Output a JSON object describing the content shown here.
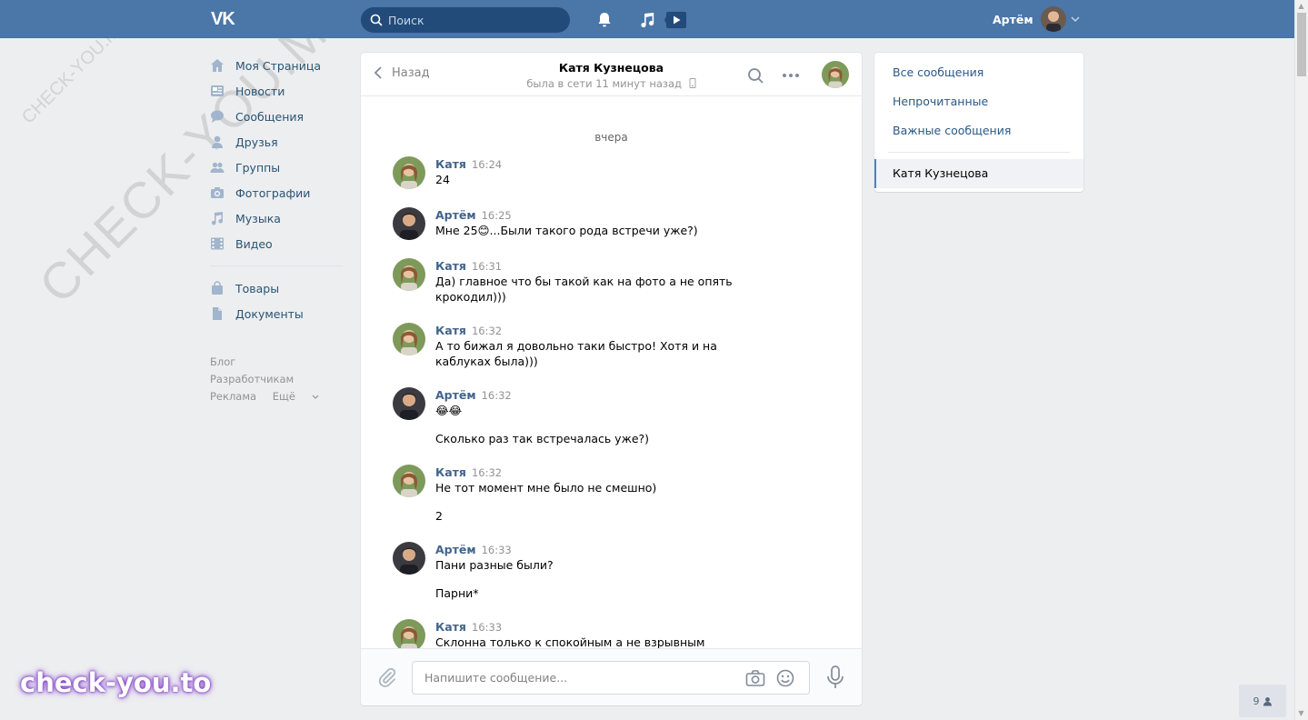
{
  "header": {
    "logo": "VK",
    "search_placeholder": "Поиск",
    "user_name": "Артём"
  },
  "leftnav": {
    "items": [
      {
        "label": "Моя Страница",
        "icon": "home-icon"
      },
      {
        "label": "Новости",
        "icon": "news-icon"
      },
      {
        "label": "Сообщения",
        "icon": "messages-icon"
      },
      {
        "label": "Друзья",
        "icon": "friends-icon"
      },
      {
        "label": "Группы",
        "icon": "groups-icon"
      },
      {
        "label": "Фотографии",
        "icon": "camera-icon"
      },
      {
        "label": "Музыка",
        "icon": "music-icon"
      },
      {
        "label": "Видео",
        "icon": "video-icon"
      }
    ],
    "items2": [
      {
        "label": "Товары",
        "icon": "bag-icon"
      },
      {
        "label": "Документы",
        "icon": "document-icon"
      }
    ],
    "footer": {
      "blog": "Блог",
      "dev": "Разработчикам",
      "ads": "Реклама",
      "more": "Ещё"
    }
  },
  "chat": {
    "back_label": "Назад",
    "peer_name": "Катя Кузнецова",
    "peer_status": "была в сети 11 минут назад",
    "day_label": "вчера",
    "messages": [
      {
        "author": "Катя",
        "time": "16:24",
        "lines": [
          "24"
        ],
        "who": "katya"
      },
      {
        "author": "Артём",
        "time": "16:25",
        "lines": [
          "Мне 25😊...Были такого рода встречи уже?)"
        ],
        "who": "artem"
      },
      {
        "author": "Катя",
        "time": "16:31",
        "lines": [
          "Да) главное что бы такой как на фото а не опять крокодил)))"
        ],
        "who": "katya"
      },
      {
        "author": "Катя",
        "time": "16:32",
        "lines": [
          "А то бижал я довольно таки быстро! Хотя и на каблуках была)))"
        ],
        "who": "katya"
      },
      {
        "author": "Артём",
        "time": "16:32",
        "lines": [
          "😂😂",
          "Сколько раз так встречалась уже?)"
        ],
        "who": "artem"
      },
      {
        "author": "Катя",
        "time": "16:32",
        "lines": [
          "Не тот момент мне было не смешно)",
          "2"
        ],
        "who": "katya"
      },
      {
        "author": "Артём",
        "time": "16:33",
        "lines": [
          "Пани разные были?",
          "Парни*"
        ],
        "who": "artem"
      },
      {
        "author": "Катя",
        "time": "16:33",
        "lines": [
          "Склонна только к спокойным а не взрывным"
        ],
        "who": "katya"
      }
    ],
    "composer_placeholder": "Напишите сообщение..."
  },
  "rightpanel": {
    "items": [
      "Все сообщения",
      "Непрочитанные",
      "Важные сообщения"
    ],
    "active_item": "Катя Кузнецова"
  },
  "online_count": "9",
  "watermarks": {
    "big": "CHECK-YOU.ME",
    "small": "CHECK-YOU.ME",
    "brand": "check-you.to"
  },
  "colors": {
    "header": "#4a76a8",
    "link": "#2a5885",
    "author": "#42648b"
  }
}
